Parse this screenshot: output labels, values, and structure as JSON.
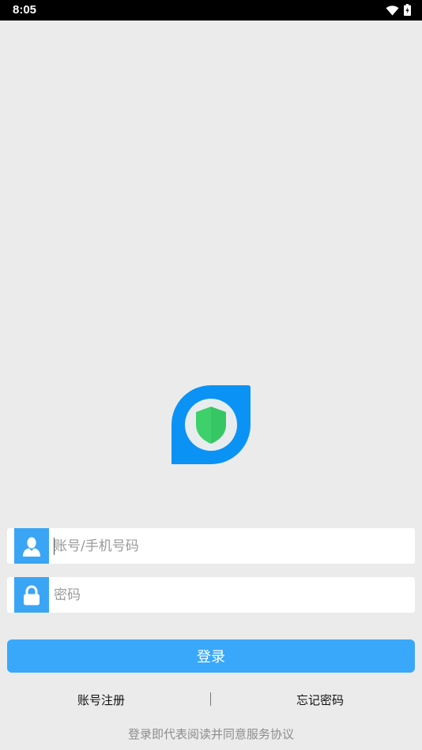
{
  "status_bar": {
    "time": "8:05",
    "icons": [
      "wifi-icon",
      "battery-charging-icon"
    ]
  },
  "logo": {
    "icon": "shield-icon",
    "colors": {
      "blue": "#0a93f5",
      "green": "#3ed06a",
      "inner": "#e9ecee"
    }
  },
  "login_form": {
    "account_placeholder": "账号/手机号码",
    "account_value": "",
    "account_icon": "user-icon",
    "password_placeholder": "密码",
    "password_value": "",
    "password_icon": "lock-icon",
    "submit_label": "登录"
  },
  "links": {
    "register": "账号注册",
    "forgot_password": "忘记密码"
  },
  "agreement_text": "登录即代表阅读并同意服务协议",
  "colors": {
    "accent": "#3aa8fa",
    "icon_tile": "#3aa5f5",
    "background": "#ebebeb"
  }
}
